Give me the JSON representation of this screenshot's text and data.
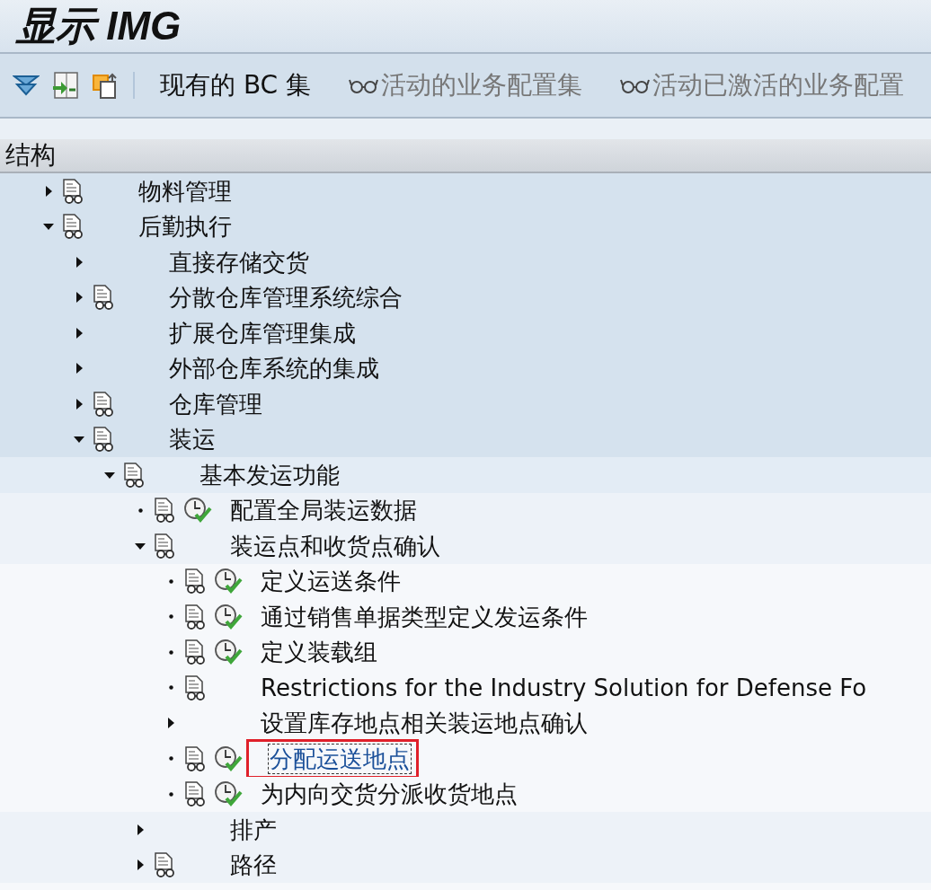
{
  "window": {
    "title": "显示 IMG"
  },
  "toolbar": {
    "buttons": [
      {
        "kind": "bcset",
        "label": "现有的 BC 集",
        "disabled": false
      },
      {
        "kind": "glasses",
        "label": "活动的业务配置集",
        "disabled": true
      },
      {
        "kind": "glasses",
        "label": "活动已激活的业务配置",
        "disabled": true
      }
    ]
  },
  "tree": {
    "header": "结构",
    "items": [
      {
        "label": "物料管理",
        "kind": "folder",
        "expanded": false,
        "doc": true,
        "activity": false,
        "selected": false
      },
      {
        "label": "后勤执行",
        "kind": "folder",
        "expanded": true,
        "doc": true,
        "activity": false,
        "selected": false,
        "children": [
          {
            "label": "直接存储交货",
            "kind": "folder",
            "expanded": false,
            "doc": false,
            "activity": false,
            "selected": false
          },
          {
            "label": "分散仓库管理系统综合",
            "kind": "folder",
            "expanded": false,
            "doc": true,
            "activity": false,
            "selected": false
          },
          {
            "label": "扩展仓库管理集成",
            "kind": "folder",
            "expanded": false,
            "doc": false,
            "activity": false,
            "selected": false
          },
          {
            "label": "外部仓库系统的集成",
            "kind": "folder",
            "expanded": false,
            "doc": false,
            "activity": false,
            "selected": false
          },
          {
            "label": "仓库管理",
            "kind": "folder",
            "expanded": false,
            "doc": true,
            "activity": false,
            "selected": false
          },
          {
            "label": "装运",
            "kind": "folder",
            "expanded": true,
            "doc": true,
            "activity": false,
            "selected": false,
            "children": [
              {
                "label": "基本发运功能",
                "kind": "folder",
                "expanded": true,
                "doc": true,
                "activity": false,
                "selected": false,
                "children": [
                  {
                    "label": "配置全局装运数据",
                    "kind": "leaf",
                    "doc": true,
                    "activity": true,
                    "selected": false
                  },
                  {
                    "label": "装运点和收货点确认",
                    "kind": "folder",
                    "expanded": true,
                    "doc": true,
                    "activity": false,
                    "selected": false,
                    "children": [
                      {
                        "label": "定义运送条件",
                        "kind": "leaf",
                        "doc": true,
                        "activity": true,
                        "selected": false
                      },
                      {
                        "label": "通过销售单据类型定义发运条件",
                        "kind": "leaf",
                        "doc": true,
                        "activity": true,
                        "selected": false
                      },
                      {
                        "label": "定义装载组",
                        "kind": "leaf",
                        "doc": true,
                        "activity": true,
                        "selected": false
                      },
                      {
                        "label": "Restrictions for the Industry Solution for Defense Fo",
                        "kind": "leaf",
                        "doc": true,
                        "activity": false,
                        "selected": false
                      },
                      {
                        "label": "设置库存地点相关装运地点确认",
                        "kind": "folder",
                        "expanded": false,
                        "doc": false,
                        "activity": false,
                        "selected": false
                      },
                      {
                        "label": "分配运送地点",
                        "kind": "leaf",
                        "doc": true,
                        "activity": true,
                        "selected": true
                      },
                      {
                        "label": "为内向交货分派收货地点",
                        "kind": "leaf",
                        "doc": true,
                        "activity": true,
                        "selected": false
                      }
                    ]
                  },
                  {
                    "label": "排产",
                    "kind": "folder",
                    "expanded": false,
                    "doc": false,
                    "activity": false,
                    "selected": false
                  },
                  {
                    "label": "路径",
                    "kind": "folder",
                    "expanded": false,
                    "doc": true,
                    "activity": false,
                    "selected": false
                  }
                ]
              }
            ]
          }
        ]
      }
    ]
  }
}
